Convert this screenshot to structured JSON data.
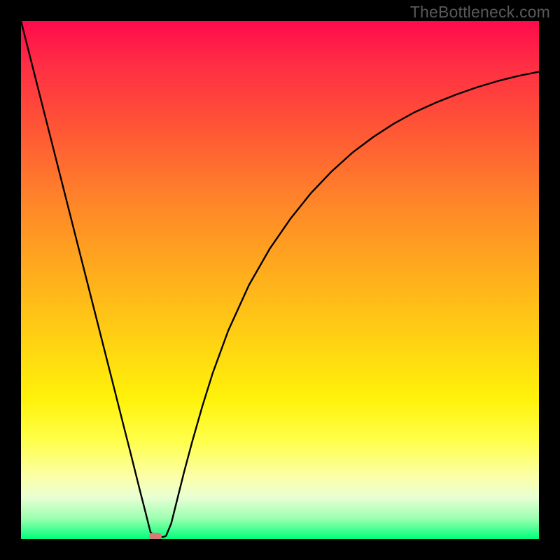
{
  "watermark": "TheBottleneck.com",
  "chart_data": {
    "type": "line",
    "title": "",
    "xlabel": "",
    "ylabel": "",
    "xlim": [
      0,
      100
    ],
    "ylim": [
      0,
      100
    ],
    "grid": false,
    "legend": false,
    "annotations": [],
    "gradient_stops": [
      {
        "pos": 0,
        "color": "#ff0a4b"
      },
      {
        "pos": 8,
        "color": "#ff2c45"
      },
      {
        "pos": 20,
        "color": "#ff5336"
      },
      {
        "pos": 33,
        "color": "#ff7f2b"
      },
      {
        "pos": 46,
        "color": "#ffa51f"
      },
      {
        "pos": 60,
        "color": "#ffcd14"
      },
      {
        "pos": 73,
        "color": "#fff20a"
      },
      {
        "pos": 81,
        "color": "#ffff4a"
      },
      {
        "pos": 88,
        "color": "#fbffa8"
      },
      {
        "pos": 92,
        "color": "#e8ffd4"
      },
      {
        "pos": 96,
        "color": "#9cffb0"
      },
      {
        "pos": 100,
        "color": "#00ff7b"
      }
    ],
    "series": [
      {
        "name": "curve",
        "color": "#000000",
        "x": [
          0.0,
          3.5,
          7.0,
          10.5,
          14.0,
          17.5,
          20.0,
          21.0,
          22.0,
          23.0,
          24.0,
          25.0,
          26.0,
          27.0,
          27.5,
          28.0,
          29.0,
          30.0,
          31.5,
          33.0,
          35.0,
          37.0,
          40.0,
          44.0,
          48.0,
          52.0,
          56.0,
          60.0,
          64.0,
          68.0,
          72.0,
          76.0,
          80.0,
          84.0,
          88.0,
          92.0,
          96.0,
          100.0
        ],
        "y": [
          100.0,
          86.2,
          72.4,
          58.6,
          44.8,
          31.0,
          21.1,
          17.2,
          13.2,
          9.2,
          5.3,
          1.3,
          0.6,
          0.4,
          0.4,
          0.6,
          3.0,
          7.0,
          13.0,
          18.6,
          25.6,
          32.0,
          40.2,
          49.0,
          56.0,
          61.8,
          66.8,
          71.0,
          74.6,
          77.6,
          80.2,
          82.4,
          84.2,
          85.8,
          87.2,
          88.4,
          89.4,
          90.2
        ]
      }
    ],
    "marker": {
      "x": 26.0,
      "y": 0.5,
      "color": "#d87a78"
    }
  }
}
